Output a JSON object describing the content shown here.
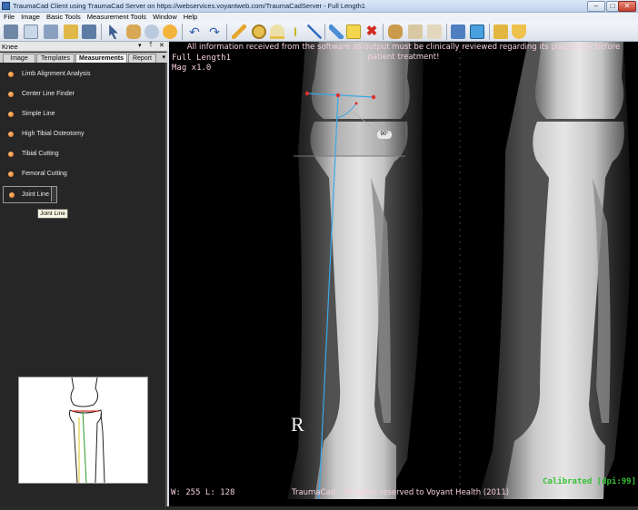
{
  "window": {
    "title": "TraumaCad Client using TraumaCad Server on https://webservices.voyantweb.com/TraumaCadServer - Full Length1",
    "minimize": "–",
    "maximize": "□",
    "close": "✕"
  },
  "menu": [
    "File",
    "Image",
    "Basic Tools",
    "Measurement Tools",
    "Window",
    "Help"
  ],
  "toolbar": {
    "icons": [
      "open-folder-icon",
      "new-study-icon",
      "list-icon",
      "zoom-icon",
      "save-icon",
      "pointer-icon",
      "pan-hand-icon",
      "magnifier-icon",
      "brightness-icon",
      "undo-icon",
      "redo-icon",
      "ruler-icon",
      "circle-icon",
      "angle-icon",
      "calibration-icon",
      "line-icon",
      "pen-icon",
      "note-icon",
      "delete-icon",
      "people-icon",
      "implant-icon",
      "bone-icon",
      "export-icon",
      "layout-icon",
      "template-icon",
      "cup-icon"
    ]
  },
  "panel": {
    "title": "Knee",
    "controls": [
      "▾",
      "†",
      "✕"
    ],
    "tabs": [
      "Image",
      "Templates",
      "Measurements",
      "Report"
    ],
    "active_tab": "Measurements",
    "items": [
      "Limb Alignment Analysis",
      "Center Line Finder",
      "Simple Line",
      "High Tibial Osteotomy",
      "Tibial Cutting",
      "Femoral Cutting",
      "Joint Line"
    ],
    "selected_item": "Joint Line",
    "tooltip": "Joint Line"
  },
  "viewer": {
    "warning": "All information received from the software as output must be clinically reviewed regarding its plausibility before patient treatment!",
    "image_name": "Full Length1",
    "magnification": "Mag x1.0",
    "side_marker": "R",
    "angle_label": "90°",
    "window_level": "W: 255 L: 128",
    "copyright": "TraumaCad -  All rights reserved to Voyant Health  (2011)",
    "calibration": "Calibrated [dpi:99]"
  },
  "colors": {
    "measure_line": "#3aa8e8",
    "measure_point": "#e03030",
    "calibrated": "#36c236",
    "overlay_text": "#f5cfe0",
    "item_dot": "#e06a14"
  }
}
